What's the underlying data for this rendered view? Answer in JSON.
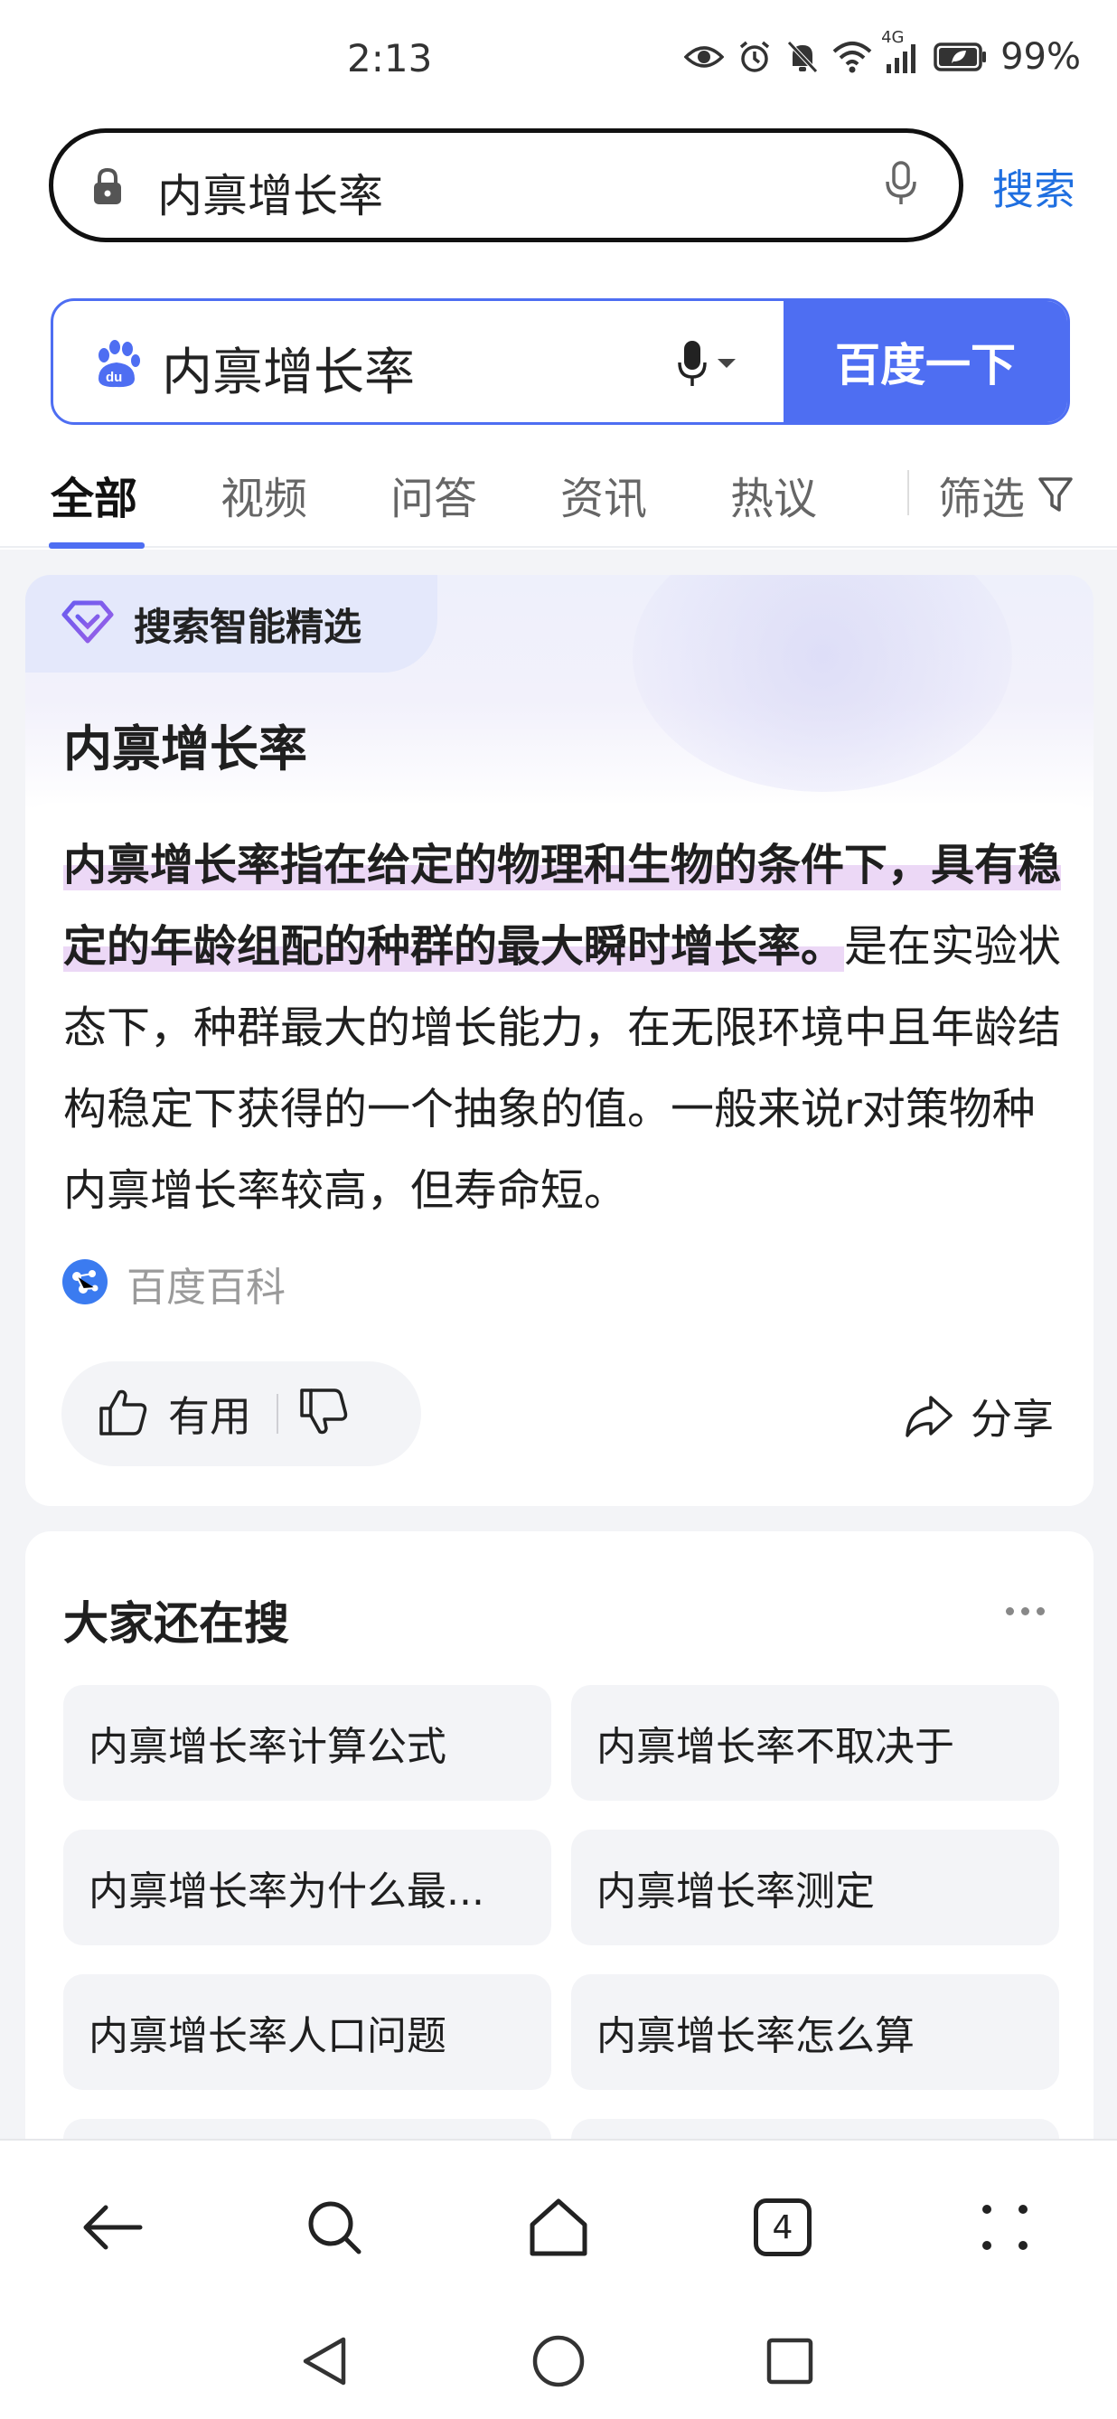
{
  "status_bar": {
    "time": "2:13",
    "network": "4G",
    "battery": "99%"
  },
  "browser": {
    "address_text": "内禀增长率",
    "search_label": "搜索"
  },
  "baidu": {
    "query": "内禀增长率",
    "submit_label": "百度一下",
    "accent": "#4e6ef2"
  },
  "tabs": [
    {
      "label": "全部",
      "active": true
    },
    {
      "label": "视频"
    },
    {
      "label": "问答"
    },
    {
      "label": "资讯"
    },
    {
      "label": "热议"
    }
  ],
  "filter_label": "筛选",
  "ai_card": {
    "badge": "搜索智能精选",
    "title": "内禀增长率",
    "highlight": "内禀增长率指在给定的物理和生物的条件下，具有稳定的年龄组配的种群的最大瞬时增长率。",
    "body": "是在实验状态下，种群最大的增长能力，在无限环境中且年龄结构稳定下获得的一个抽象的值。一般来说r对策物种内禀增长率较高，但寿命短。",
    "source": "百度百科",
    "useful_label": "有用",
    "share_label": "分享"
  },
  "related": {
    "title": "大家还在搜",
    "items": [
      "内禀增长率计算公式",
      "内禀增长率不取决于",
      "内禀增长率为什么最...",
      "内禀增长率测定",
      "内禀增长率人口问题",
      "内禀增长率怎么算"
    ]
  },
  "toolbar": {
    "tabs_count": "4"
  }
}
